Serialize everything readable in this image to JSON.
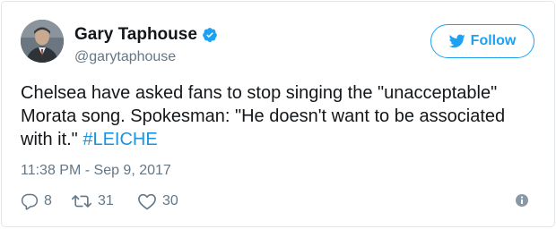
{
  "author": {
    "display_name": "Gary Taphouse",
    "handle": "@garytaphouse",
    "verified_icon": "verified-badge-icon",
    "avatar": "avatar"
  },
  "follow_button": {
    "label": "Follow",
    "icon": "twitter-bird-icon"
  },
  "tweet": {
    "text_main": "Chelsea have asked fans to stop singing the \"unacceptable\" Morata song. Spokesman: \"He doesn't want to be associated with it.\" ",
    "hashtag": "#LEICHE",
    "timestamp": "11:38 PM - Sep 9, 2017"
  },
  "actions": {
    "reply": {
      "icon": "reply-icon",
      "count": "8"
    },
    "retweet": {
      "icon": "retweet-icon",
      "count": "31"
    },
    "like": {
      "icon": "heart-icon",
      "count": "30"
    },
    "info": {
      "icon": "info-icon"
    }
  },
  "colors": {
    "accent": "#1da1f2",
    "hashtag": "#1b95e0",
    "secondary_text": "#657786",
    "primary_text": "#14171a",
    "border": "#e1e8ed"
  }
}
